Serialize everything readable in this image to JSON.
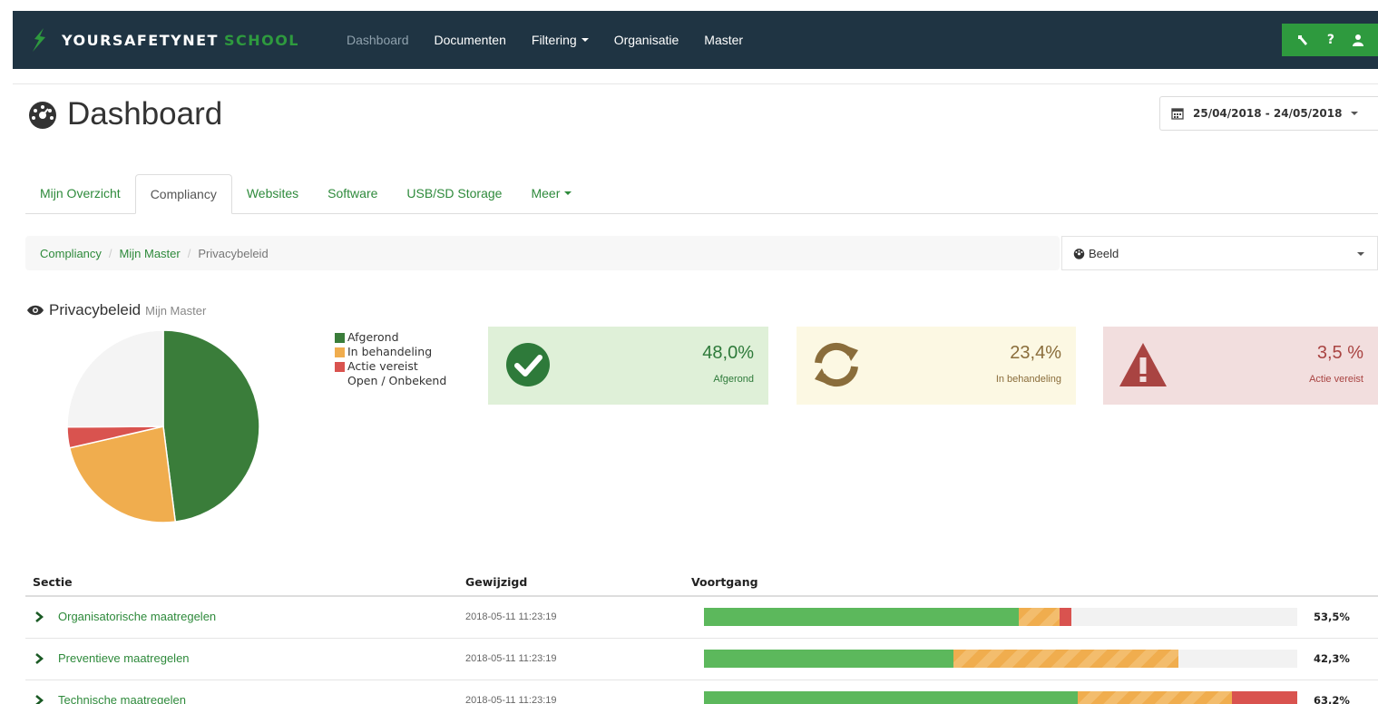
{
  "brand": {
    "name_primary": "YOURSAFETYNET",
    "name_secondary": "SCHOOL",
    "colors": {
      "navbar": "#1f3443",
      "accent": "#2e9a3e"
    }
  },
  "nav": {
    "items": [
      {
        "label": "Dashboard",
        "active": true
      },
      {
        "label": "Documenten"
      },
      {
        "label": "Filtering",
        "dropdown": true
      },
      {
        "label": "Organisatie"
      },
      {
        "label": "Master"
      }
    ],
    "right_icons": [
      "wrench-icon",
      "help-icon",
      "user-icon"
    ],
    "help_label": "?"
  },
  "page": {
    "title": "Dashboard",
    "date_range": "25/04/2018 - 24/05/2018"
  },
  "tabs": [
    {
      "label": "Mijn Overzicht"
    },
    {
      "label": "Compliancy",
      "active": true
    },
    {
      "label": "Websites"
    },
    {
      "label": "Software"
    },
    {
      "label": "USB/SD Storage"
    },
    {
      "label": "Meer",
      "dropdown": true
    }
  ],
  "breadcrumb": [
    "Compliancy",
    "Mijn Master",
    "Privacybeleid"
  ],
  "view_select": {
    "label": "Beeld"
  },
  "section": {
    "title": "Privacybeleid",
    "subtitle": "Mijn Master"
  },
  "chart_data": {
    "type": "pie",
    "categories": [
      "Afgerond",
      "In behandeling",
      "Actie vereist",
      "Open / Onbekend"
    ],
    "values": [
      48.0,
      23.4,
      3.5,
      25.1
    ],
    "colors": [
      "#3a7d3a",
      "#f0ad4e",
      "#d9534f",
      "#f4f4f4"
    ],
    "legend_position": "right"
  },
  "legend": [
    {
      "label": "Afgerond",
      "color": "#3a7d3a"
    },
    {
      "label": "In behandeling",
      "color": "#f0ad4e"
    },
    {
      "label": "Actie vereist",
      "color": "#d9534f"
    },
    {
      "label": "Open / Onbekend",
      "color": "#ffffff"
    }
  ],
  "stats": {
    "done": {
      "value": "48,0%",
      "label": "Afgerond"
    },
    "progress": {
      "value": "23,4%",
      "label": "In behandeling"
    },
    "action": {
      "value": "3,5 %",
      "label": "Actie vereist"
    }
  },
  "table": {
    "headers": {
      "section": "Sectie",
      "modified": "Gewijzigd",
      "progress": "Voortgang"
    },
    "rows": [
      {
        "section": "Organisatorische maatregelen",
        "modified": "2018-05-11 11:23:19",
        "percent": "53,5%",
        "segments": {
          "green": 53.0,
          "orange": 7.0,
          "red": 2.0
        }
      },
      {
        "section": "Preventieve maatregelen",
        "modified": "2018-05-11 11:23:19",
        "percent": "42,3%",
        "segments": {
          "green": 42.0,
          "orange": 38.0,
          "red": 0
        }
      },
      {
        "section": "Technische maatregelen",
        "modified": "2018-05-11 11:23:19",
        "percent": "63,2%",
        "segments": {
          "green": 63.0,
          "orange": 26.0,
          "red": 11.0
        }
      }
    ]
  }
}
